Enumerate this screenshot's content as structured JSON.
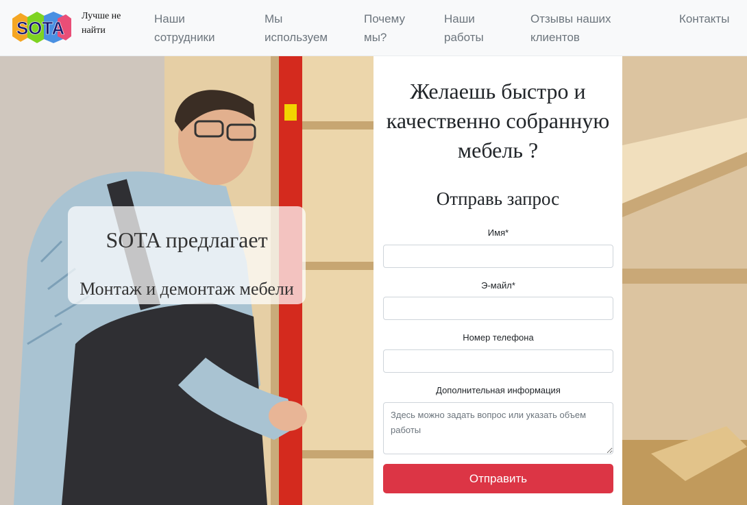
{
  "brand": {
    "logo_text": "SOTA",
    "tagline": "Лучше не найти"
  },
  "nav": {
    "items": [
      {
        "label": "Наши сотрудники"
      },
      {
        "label": "Мы используем"
      },
      {
        "label": "Почему мы?"
      },
      {
        "label": "Наши работы"
      },
      {
        "label": "Отзывы наших клиентов"
      },
      {
        "label": "Контакты"
      }
    ]
  },
  "hero": {
    "offer_title": "SOTA предлагает",
    "offer_subtitle": "Монтаж и демонтаж мебели"
  },
  "form": {
    "heading": "Желаешь быстро и качественно собранную мебель ?",
    "subheading": "Отправь запрос",
    "name_label": "Имя*",
    "name_value": "",
    "email_label": "Э-майл*",
    "email_value": "",
    "phone_label": "Номер телефона",
    "phone_value": "",
    "info_label": "Дополнительная информация",
    "info_placeholder": "Здесь можно задать вопрос или указать объем работы",
    "submit_label": "Отправить"
  },
  "colors": {
    "navbar_bg": "#f8f9fa",
    "nav_link": "#6c757d",
    "submit_bg": "#dc3545",
    "level_red": "#d42a1e"
  }
}
